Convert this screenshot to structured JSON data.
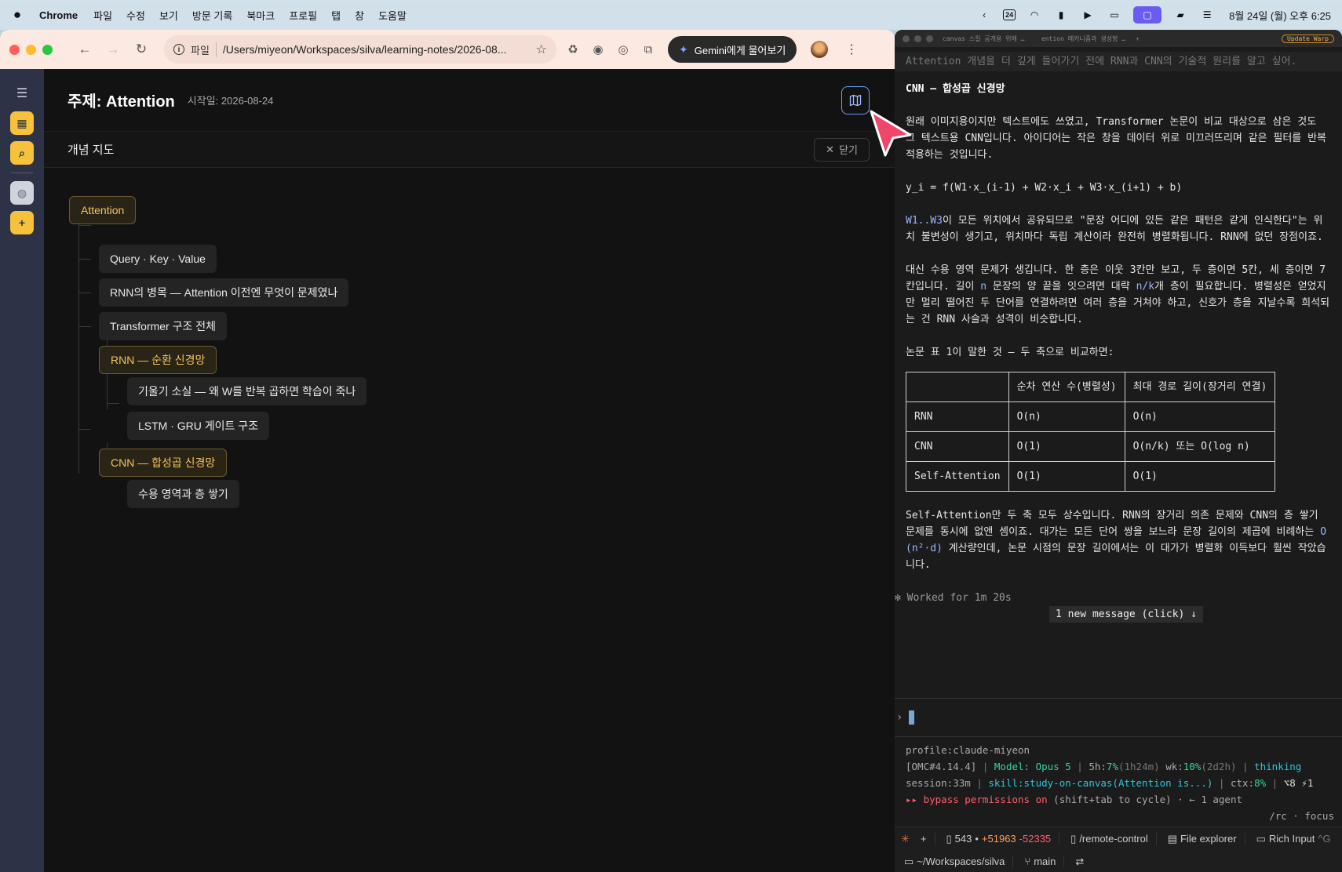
{
  "menubar": {
    "app_name": "Chrome",
    "items": [
      "파일",
      "수정",
      "보기",
      "방문 기록",
      "북마크",
      "프로필",
      "탭",
      "창",
      "도움말"
    ],
    "calendar_day": "24",
    "clock": "8월 24일 (월) 오후 6:25"
  },
  "chrome": {
    "omnibox": {
      "scheme_label": "파일",
      "url": "/Users/miyeon/Workspaces/silva/learning-notes/2026-08..."
    },
    "gemini_label": "Gemini에게 물어보기"
  },
  "topic": {
    "title": "주제: Attention",
    "start_date": "시작일: 2026-08-24"
  },
  "concept_map": {
    "title": "개념 지도",
    "close_label": "닫기",
    "nodes": [
      "Attention",
      "Query · Key · Value",
      "RNN의 병목 — Attention 이전엔 무엇이 문제였나",
      "Transformer 구조 전체",
      "RNN — 순환 신경망",
      "기울기 소실 — 왜 W를 반복 곱하면 학습이 죽나",
      "LSTM · GRU 게이트 구조",
      "CNN — 합성곱 신경망",
      "수용 영역과 층 쌓기"
    ]
  },
  "terminal": {
    "tabs": [
      "canvas 스킬 공개용 위에 설정 검토",
      "ention 메커니즘과 생성형 AI의 발전"
    ],
    "update_label": "Update Warp",
    "prompt_echo": "Attention 개념을 더 깊게 들어가기 전에 RNN과 CNN의 기술적 원리를 알고 싶어.",
    "heading": "CNN — 합성곱 신경망",
    "p1": "원래 이미지용이지만 텍스트에도 쓰였고, Transformer 논문이 비교 대상으로 삼은 것도 그 텍스트용 CNN입니다. 아이디어는 작은 창을 데이터 위로 미끄러뜨리며 같은 필터를 반복 적용하는 것입니다.",
    "formula": "y_i = f(W1·x_(i-1) + W2·x_i + W3·x_(i+1) + b)",
    "p2_code": "W1..W3",
    "p2_rest": "이 모든 위치에서 공유되므로 \"문장 어디에 있든 같은 패턴은 같게 인식한다\"는 위치 불변성이 생기고, 위치마다 독립 계산이라 완전히 병렬화됩니다. RNN에 없던 장점이죠.",
    "p3_a": "대신 수용 영역 문제가 생깁니다. 한 층은 이웃 3칸만 보고, 두 층이면 5칸, 세 층이면 7칸입니다. 길이 ",
    "p3_n": "n",
    "p3_b": " 문장의 양 끝을 잇으려면 대략 ",
    "p3_nk": "n/k",
    "p3_c": "개 층이 필요합니다. 병렬성은 얻었지만 멀리 떨어진 두 단어를 연결하려면 여러 층을 거쳐야 하고, 신호가 층을 지날수록 희석되는 건 RNN 사슬과 성격이 비슷합니다.",
    "p4": "논문 표 1이 말한 것 — 두 축으로 비교하면:",
    "table": {
      "headers": [
        "",
        "순차 연산 수(병렬성)",
        "최대 경로 길이(장거리 연결)"
      ],
      "rows": [
        [
          "RNN",
          "O(n)",
          "O(n)"
        ],
        [
          "CNN",
          "O(1)",
          "O(n/k) 또는 O(log n)"
        ],
        [
          "Self-Attention",
          "O(1)",
          "O(1)"
        ]
      ]
    },
    "p5_a": "Self-Attention만 두 축 모두 상수입니다. RNN의 장거리 의존 문제와 CNN의 층 쌓기 문제를 동시에 없앤 셈이죠. 대가는 모든 단어 쌍을 보느라 문장 길이의 제곱에 비례하는 ",
    "p5_code": "O(n²·d)",
    "p5_b": " 계산량인데, 논문 시점의 문장 길이에서는 이 대가가 병렬화 이득보다 훨씬 작았습니다.",
    "worked": "✻ Worked for 1m 20s",
    "new_message": "1 new message (click) ↓",
    "input_prompt": "›",
    "status": {
      "profile": "profile:claude-miyeon",
      "omc": "[OMC#4.14.4]",
      "model": "Model: Opus 5",
      "five_h_label": "5h:",
      "five_h_pct": "7%",
      "five_h_reset": "(1h24m)",
      "wk_label": "wk:",
      "wk_pct": "10%",
      "wk_reset": "(2d2h)",
      "thinking": "thinking",
      "session": "session:33m",
      "skill": "skill:study-on-canvas(Attention is...)",
      "ctx_label": "ctx:",
      "ctx_pct": "8%",
      "tools": "⌥8 ⚡1",
      "bypass_arrow": "▸▸",
      "bypass": "bypass permissions on",
      "bypass_hint": "(shift+tab to cycle) · ← 1 agent",
      "rc_hint": "/rc · focus"
    },
    "bottom_bar": {
      "files_count": "543",
      "added": "+51963",
      "removed": "-52335",
      "remote_control": "/remote-control",
      "file_explorer": "File explorer",
      "rich_input": "Rich Input",
      "rich_input_shortcut": "^G",
      "cwd": "~/Workspaces/silva",
      "branch": "main"
    }
  },
  "colors": {
    "accent_yellow": "#f6c23b",
    "branch_text": "#f2c45c",
    "pointer_red": "#f0466a",
    "link_blue": "#6c9cff"
  }
}
